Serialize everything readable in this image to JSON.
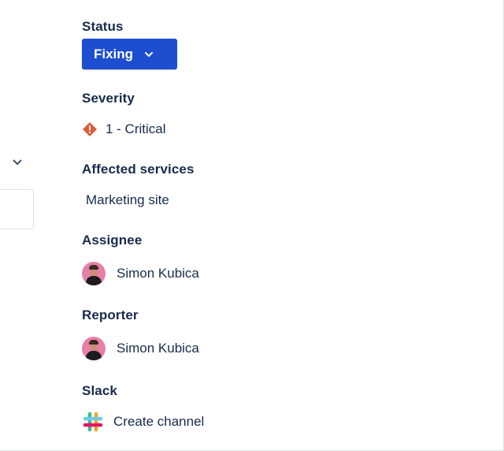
{
  "status": {
    "label": "Status",
    "value": "Fixing",
    "button_color": "#1d4ed0"
  },
  "severity": {
    "label": "Severity",
    "value": "1 - Critical",
    "icon": "critical-diamond-icon",
    "icon_color": "#de5a3a"
  },
  "affected_services": {
    "label": "Affected services",
    "items": [
      "Marketing site"
    ]
  },
  "assignee": {
    "label": "Assignee",
    "name": "Simon Kubica"
  },
  "reporter": {
    "label": "Reporter",
    "name": "Simon Kubica"
  },
  "slack": {
    "label": "Slack",
    "action": "Create channel",
    "icon": "slack-icon"
  }
}
